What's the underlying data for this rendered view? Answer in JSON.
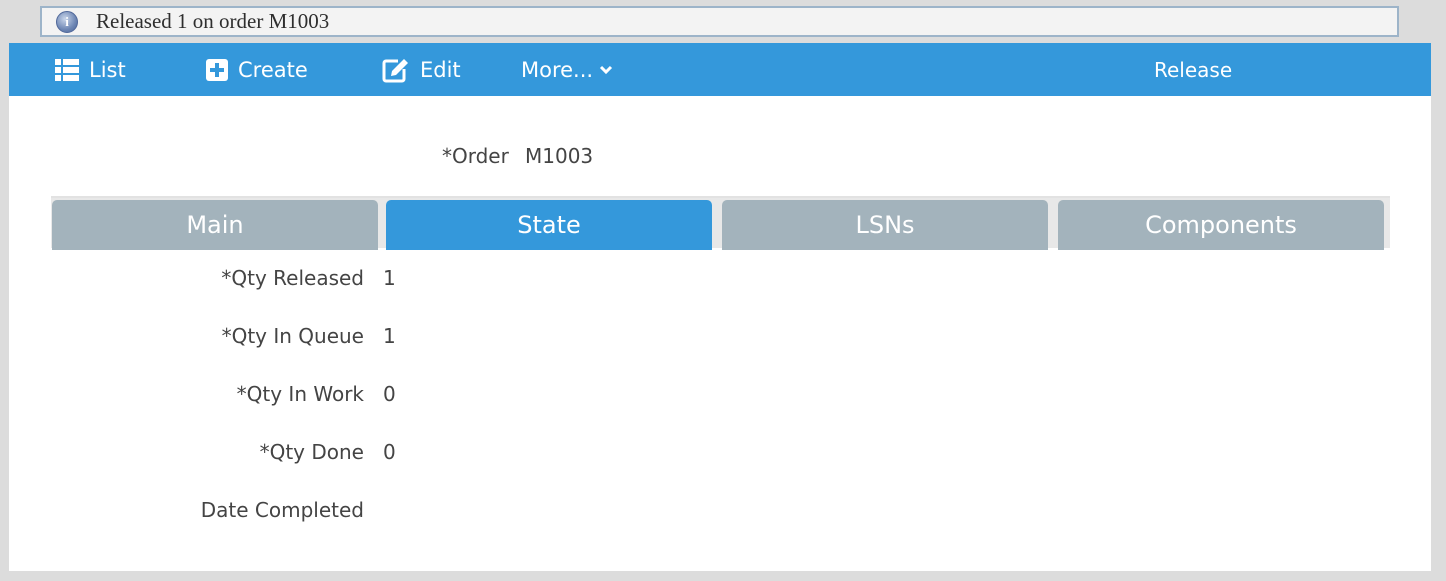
{
  "message": {
    "icon": "info-icon",
    "text": "Released 1 on order M1003"
  },
  "toolbar": {
    "list_label": "List",
    "create_label": "Create",
    "edit_label": "Edit",
    "more_label": "More...",
    "release_label": "Release"
  },
  "order": {
    "label": "*Order",
    "value": "M1003"
  },
  "tabs": [
    {
      "label": "Main",
      "active": false
    },
    {
      "label": "State",
      "active": true
    },
    {
      "label": "LSNs",
      "active": false
    },
    {
      "label": "Components",
      "active": false
    }
  ],
  "fields": [
    {
      "label": "*Qty Released",
      "value": "1"
    },
    {
      "label": "*Qty In Queue",
      "value": "1"
    },
    {
      "label": "*Qty In Work",
      "value": "0"
    },
    {
      "label": "*Qty Done",
      "value": "0"
    },
    {
      "label": "Date Completed",
      "value": ""
    }
  ],
  "colors": {
    "toolbar": "#3498db",
    "tab_inactive": "#a3b3bc",
    "tab_active": "#3498db"
  }
}
